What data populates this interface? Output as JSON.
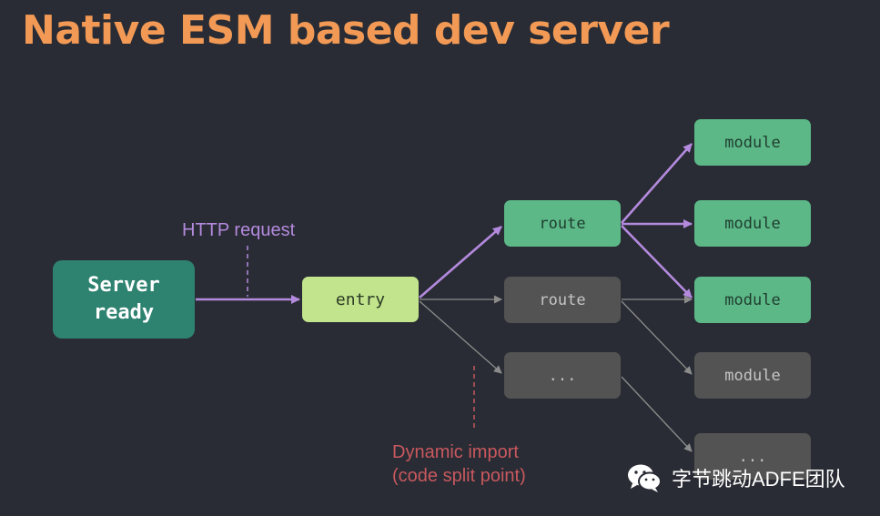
{
  "title": "Native ESM based dev server",
  "nodes": {
    "server": "Server\nready",
    "entry": "entry",
    "route_active": "route",
    "route_inactive": "route",
    "placeholder_mid": "...",
    "module_1": "module",
    "module_2": "module",
    "module_3": "module",
    "module_4": "module",
    "placeholder_bottom": "..."
  },
  "labels": {
    "http_request": "HTTP request",
    "dynamic_import": "Dynamic import\n(code split point)"
  },
  "watermark": {
    "text": "字节跳动ADFE团队",
    "icon": "wechat-icon"
  },
  "colors": {
    "background": "#292c34",
    "title": "#f29a55",
    "active_edge": "#b48ade",
    "inactive_edge": "#8c8c8c",
    "dynamic_import": "#c9585f",
    "server_node": "#2e8270",
    "entry_node": "#c2e48c",
    "active_node": "#5cb887",
    "inactive_node": "#535353"
  }
}
